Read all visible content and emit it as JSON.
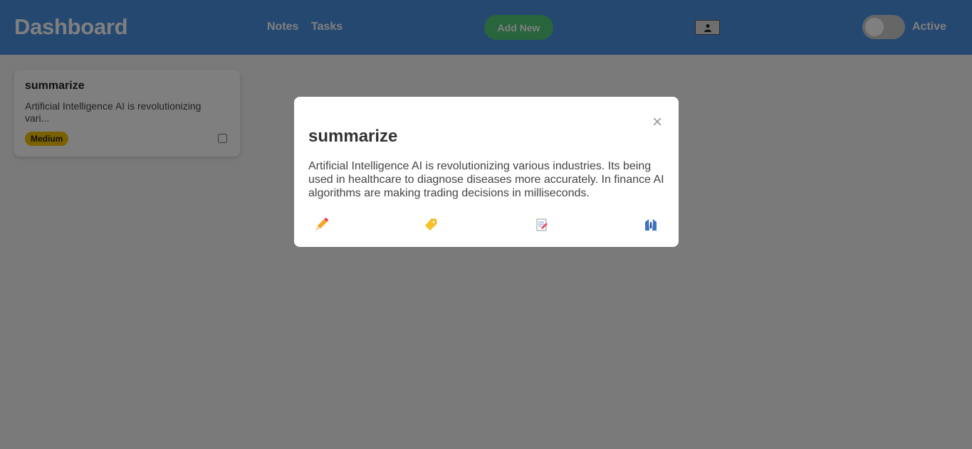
{
  "header": {
    "brand": "Dashboard",
    "nav": {
      "notes": "Notes",
      "tasks": "Tasks"
    },
    "add_button": "Add New",
    "toggle_label": "Active",
    "toggle_state": "off"
  },
  "notes": [
    {
      "title": "summarize",
      "preview": "Artificial Intelligence AI is revolutionizing vari...",
      "priority": "Medium",
      "checked": false
    }
  ],
  "modal": {
    "title": "summarize",
    "body": "Artificial Intelligence AI is revolutionizing various industries. Its being used in healthcare to diagnose diseases more accurately. In finance AI algorithms are making trading decisions in milliseconds.",
    "close_glyph": "×",
    "actions": [
      "pencil-icon",
      "tag-icon",
      "memo-icon",
      "suit-icon"
    ]
  },
  "colors": {
    "header": "#4a90e2",
    "add_button": "#50c878",
    "badge_medium": "#f3c200"
  }
}
